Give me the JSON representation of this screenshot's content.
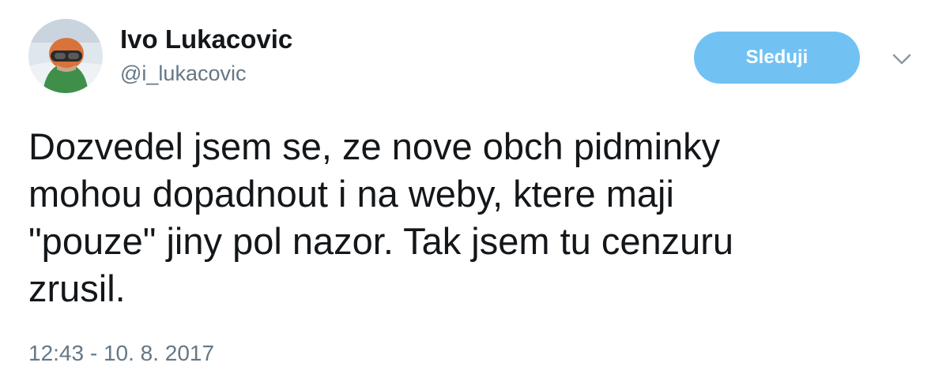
{
  "user": {
    "display_name": "Ivo Lukacovic",
    "screen_name": "@i_lukacovic",
    "avatar_icon": "user-avatar-photo"
  },
  "actions": {
    "follow_label": "Sleduji",
    "more_icon": "chevron-down-icon"
  },
  "tweet": {
    "lines": [
      "Dozvedel jsem se, ze nove obch pidminky",
      "mohou dopadnout i na weby, ktere maji",
      "\"pouze\" jiny pol nazor. Tak jsem tu cenzuru",
      "zrusil."
    ],
    "timestamp": "12:43 - 10. 8. 2017"
  },
  "colors": {
    "follow_button": "#71c2f3",
    "secondary_text": "#657786",
    "primary_text": "#14171a"
  }
}
